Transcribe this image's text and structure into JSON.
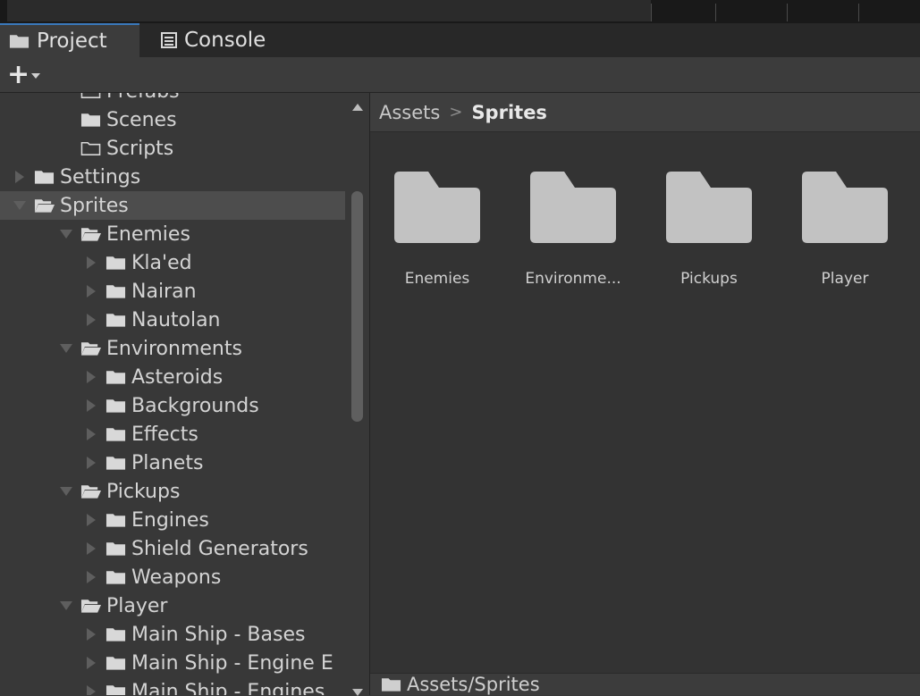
{
  "tabs": [
    {
      "label": "Project",
      "icon": "folder-icon",
      "active": true
    },
    {
      "label": "Console",
      "icon": "console-icon",
      "active": false
    }
  ],
  "toolbar": {
    "add_label": "+"
  },
  "tree": [
    {
      "label": "Prefabs",
      "indent": 2,
      "arrow": "none",
      "folder": "outline",
      "clipped": true
    },
    {
      "label": "Scenes",
      "indent": 2,
      "arrow": "none",
      "folder": "closed"
    },
    {
      "label": "Scripts",
      "indent": 2,
      "arrow": "none",
      "folder": "outline"
    },
    {
      "label": "Settings",
      "indent": 1,
      "arrow": "right",
      "folder": "closed"
    },
    {
      "label": "Sprites",
      "indent": 1,
      "arrow": "down",
      "folder": "open",
      "selected": true
    },
    {
      "label": "Enemies",
      "indent": 2,
      "arrow": "down",
      "folder": "open"
    },
    {
      "label": "Kla'ed",
      "indent": 3,
      "arrow": "right",
      "folder": "closed"
    },
    {
      "label": "Nairan",
      "indent": 3,
      "arrow": "right",
      "folder": "closed"
    },
    {
      "label": "Nautolan",
      "indent": 3,
      "arrow": "right",
      "folder": "closed"
    },
    {
      "label": "Environments",
      "indent": 2,
      "arrow": "down",
      "folder": "open"
    },
    {
      "label": "Asteroids",
      "indent": 3,
      "arrow": "right",
      "folder": "closed"
    },
    {
      "label": "Backgrounds",
      "indent": 3,
      "arrow": "right",
      "folder": "closed"
    },
    {
      "label": "Effects",
      "indent": 3,
      "arrow": "right",
      "folder": "closed"
    },
    {
      "label": "Planets",
      "indent": 3,
      "arrow": "right",
      "folder": "closed"
    },
    {
      "label": "Pickups",
      "indent": 2,
      "arrow": "down",
      "folder": "open"
    },
    {
      "label": "Engines",
      "indent": 3,
      "arrow": "right",
      "folder": "closed"
    },
    {
      "label": "Shield Generators",
      "indent": 3,
      "arrow": "right",
      "folder": "closed"
    },
    {
      "label": "Weapons",
      "indent": 3,
      "arrow": "right",
      "folder": "closed"
    },
    {
      "label": "Player",
      "indent": 2,
      "arrow": "down",
      "folder": "open"
    },
    {
      "label": "Main Ship - Bases",
      "indent": 3,
      "arrow": "right",
      "folder": "closed"
    },
    {
      "label": "Main Ship - Engine E",
      "indent": 3,
      "arrow": "right",
      "folder": "closed"
    },
    {
      "label": "Main Ship - Engines",
      "indent": 3,
      "arrow": "right",
      "folder": "closed"
    }
  ],
  "breadcrumb": {
    "root": "Assets",
    "separator": ">",
    "current": "Sprites"
  },
  "grid": {
    "items": [
      {
        "label": "Enemies"
      },
      {
        "label": "Environme..."
      },
      {
        "label": "Pickups"
      },
      {
        "label": "Player"
      }
    ]
  },
  "status": {
    "path": "Assets/Sprites"
  },
  "colors": {
    "panel_bg": "#383838",
    "grid_bg": "#333333",
    "selected_row": "#4d4d4d",
    "folder_fill": "#c2c2c2",
    "active_tab_accent": "#3a79bb"
  }
}
